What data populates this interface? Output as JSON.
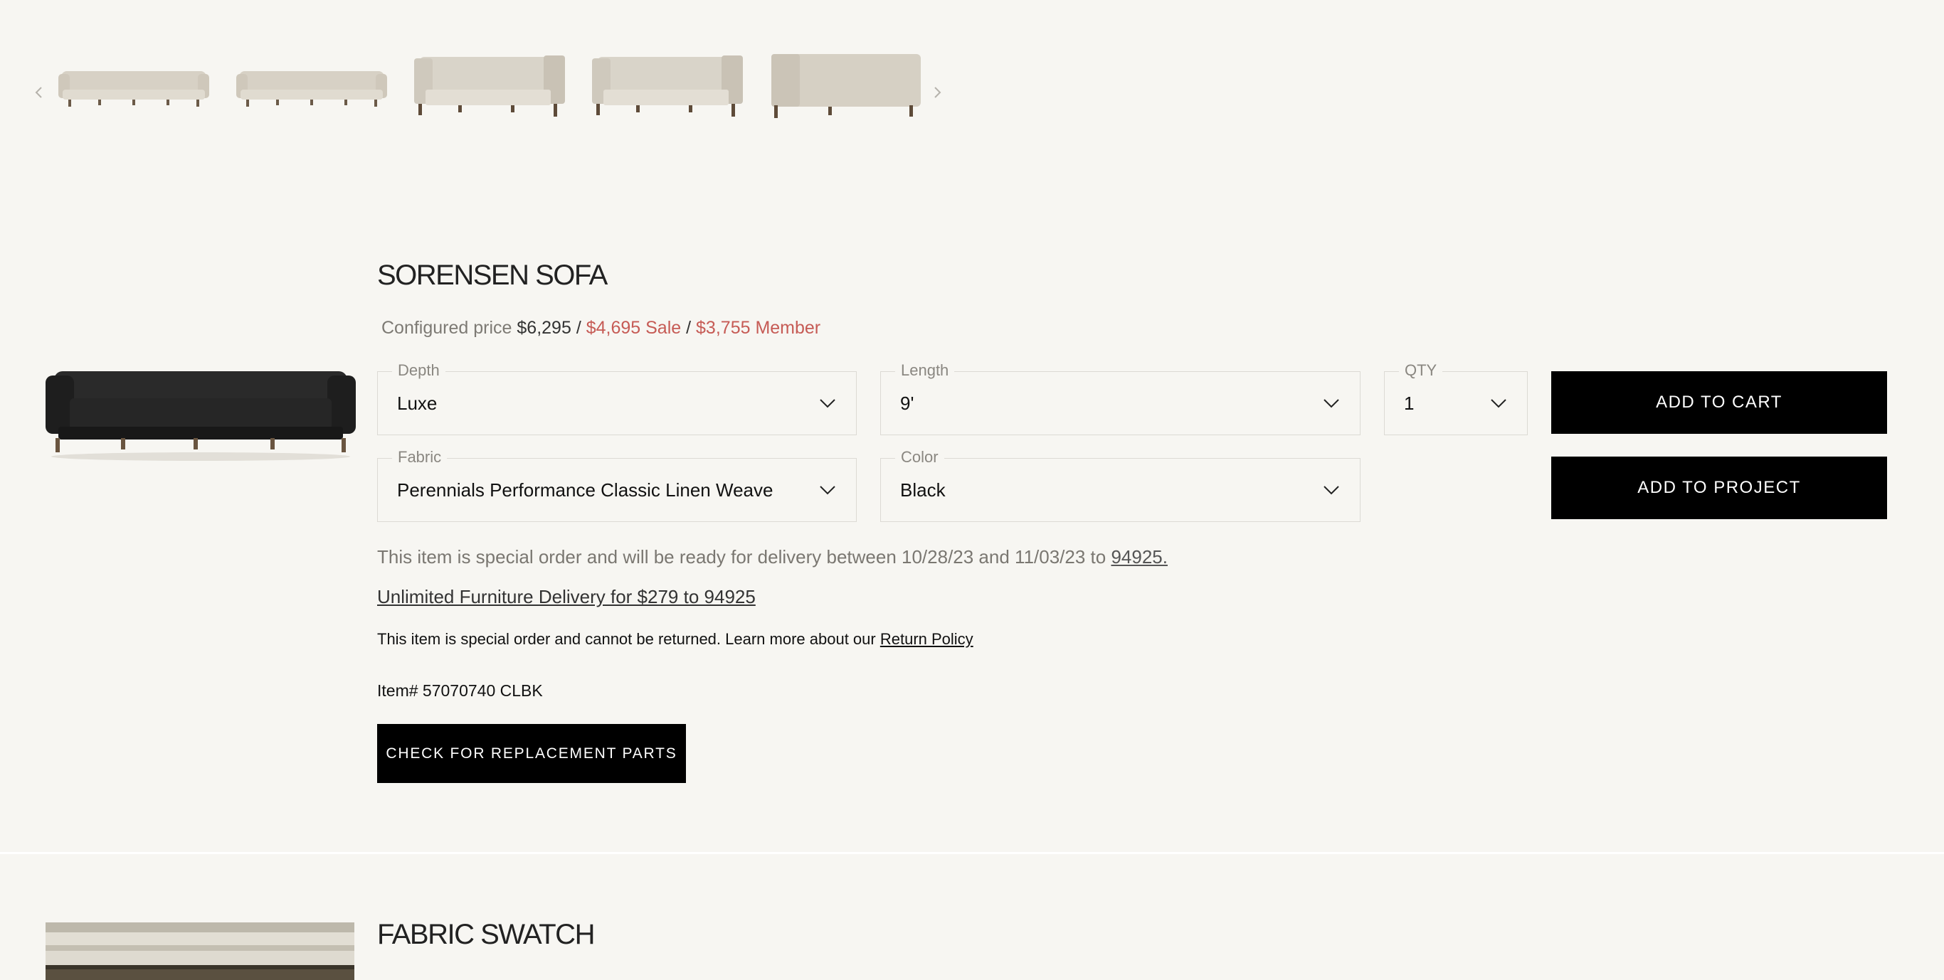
{
  "carousel": {
    "prev_icon": "chevron-left-icon",
    "next_icon": "chevron-right-icon",
    "thumb_count": 5
  },
  "product": {
    "title": "SORENSEN SOFA",
    "price": {
      "configured_label": "Configured price",
      "configured_value": "$6,295",
      "separator": "/",
      "sale": "$4,695 Sale",
      "member": "$3,755 Member"
    },
    "options": {
      "depth": {
        "label": "Depth",
        "value": "Luxe"
      },
      "length": {
        "label": "Length",
        "value": "9'"
      },
      "qty": {
        "label": "QTY",
        "value": "1"
      },
      "fabric": {
        "label": "Fabric",
        "value": "Perennials Performance Classic Linen Weave"
      },
      "color": {
        "label": "Color",
        "value": "Black"
      }
    },
    "add_to_cart": "ADD TO CART",
    "add_to_project": "ADD TO PROJECT",
    "delivery_text": "This item is special order and will be ready for delivery between 10/28/23 and 11/03/23 to ",
    "delivery_zip": "94925.",
    "unlimited_delivery": "Unlimited Furniture Delivery for $279 to 94925",
    "return_text": "This item is special order and cannot be returned. Learn more about our ",
    "return_link": "Return Policy",
    "item_number": "Item# 57070740 CLBK",
    "replacement_parts": "CHECK FOR REPLACEMENT PARTS"
  },
  "swatch": {
    "title": "FABRIC SWATCH",
    "subtitle": ""
  },
  "colors": {
    "background": "#f7f6f2",
    "sale": "#c65b55",
    "button": "#000000"
  }
}
